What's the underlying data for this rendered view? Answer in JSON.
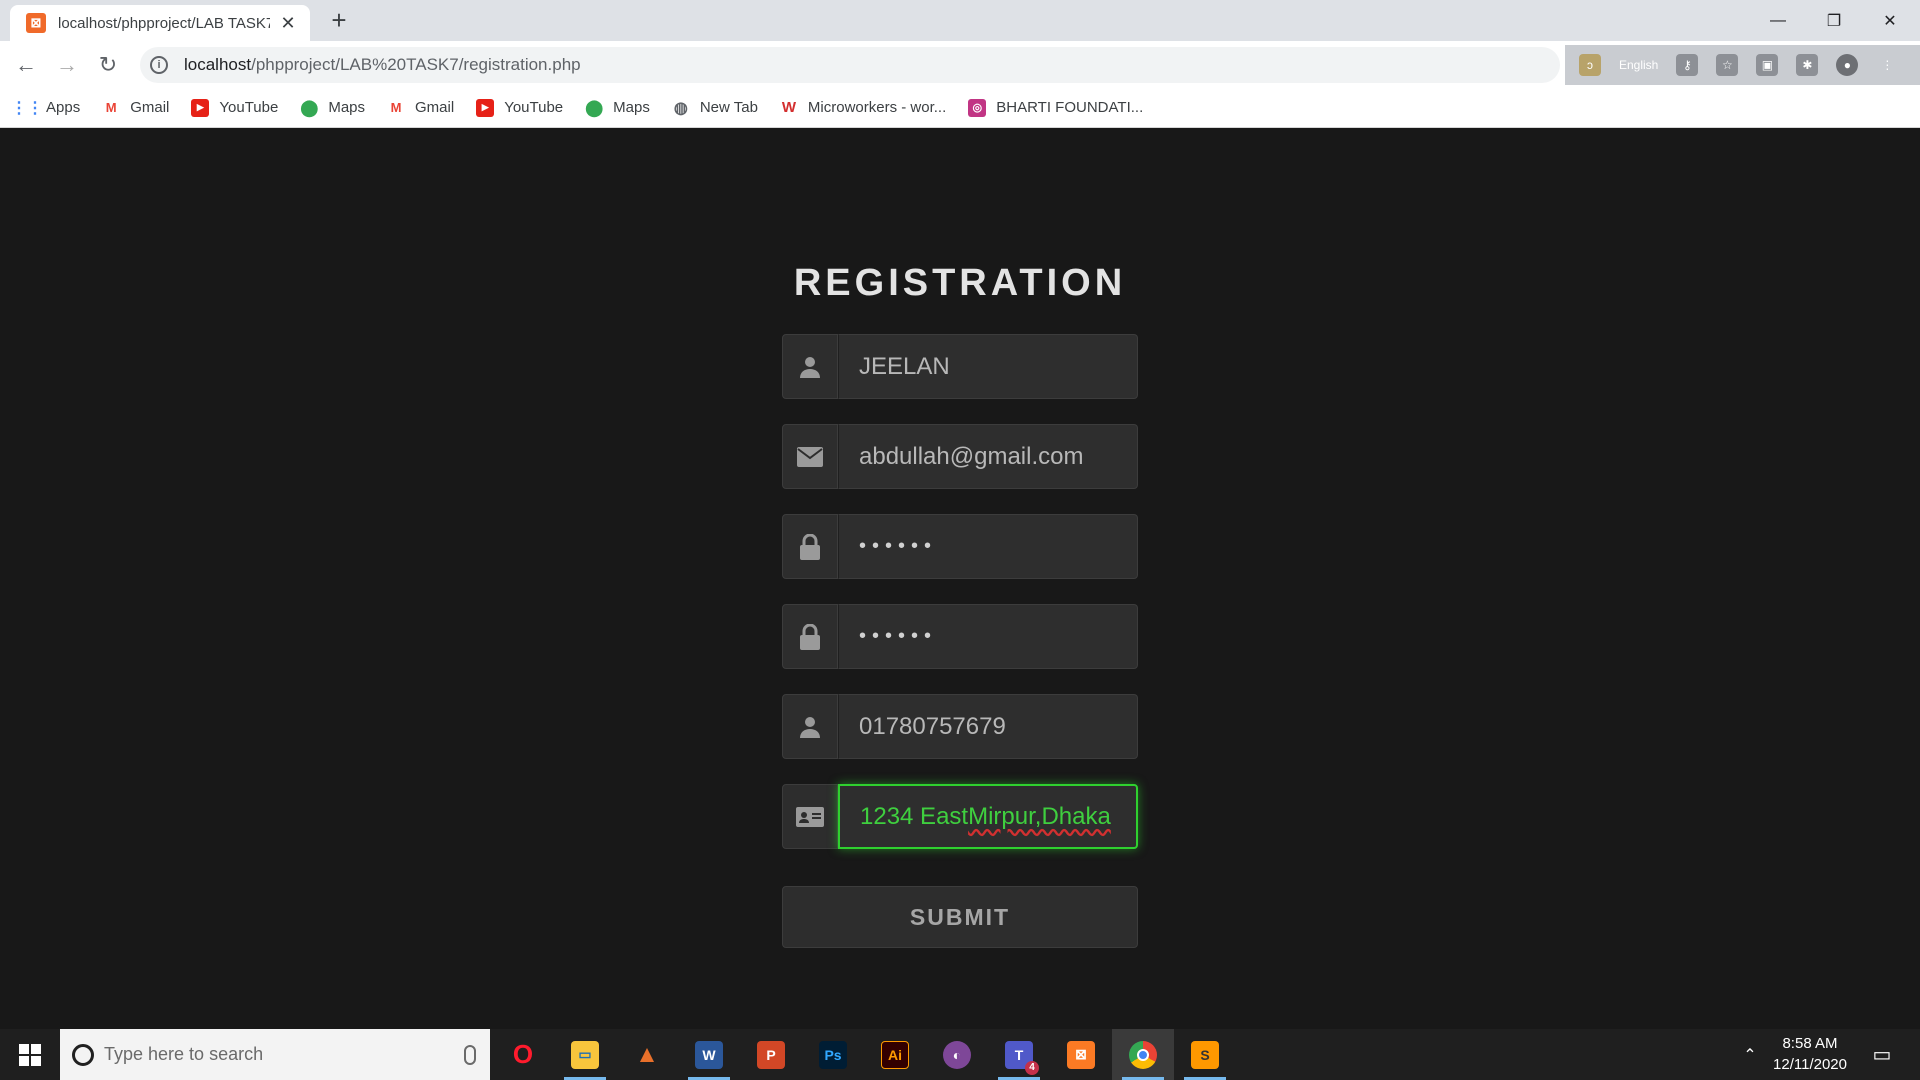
{
  "browser": {
    "tab_title": "localhost/phpproject/LAB TASK7/",
    "url_host": "localhost",
    "url_path": "/phpproject/LAB%20TASK7/registration.php",
    "extension_lang": "English"
  },
  "bookmarks": [
    {
      "label": "Apps",
      "icon": "apps-grid-icon"
    },
    {
      "label": "Gmail",
      "icon": "gmail-icon"
    },
    {
      "label": "YouTube",
      "icon": "youtube-icon"
    },
    {
      "label": "Maps",
      "icon": "maps-icon"
    },
    {
      "label": "Gmail",
      "icon": "gmail-icon"
    },
    {
      "label": "YouTube",
      "icon": "youtube-icon"
    },
    {
      "label": "Maps",
      "icon": "maps-icon"
    },
    {
      "label": "New Tab",
      "icon": "globe-icon"
    },
    {
      "label": "Microworkers - wor...",
      "icon": "microworkers-icon"
    },
    {
      "label": "BHARTI FOUNDATI...",
      "icon": "instagram-icon"
    }
  ],
  "form": {
    "title": "REGISTRATION",
    "name_value": "JEELAN",
    "email_value": "abdullah@gmail.com",
    "password_value": "••••••",
    "confirm_password_value": "••••••",
    "phone_value": "01780757679",
    "address_value_start": "1234 East ",
    "address_value_underlined": "Mirpur,Dhaka",
    "submit_label": "SUBMIT"
  },
  "colors": {
    "page_background": "#181818",
    "focus_accent": "#2fd12f"
  },
  "taskbar": {
    "search_placeholder": "Type here to search",
    "time": "8:58 AM",
    "date": "12/11/2020",
    "apps": [
      "opera",
      "file-explorer",
      "matlab",
      "word",
      "powerpoint",
      "photoshop",
      "illustrator",
      "tor",
      "teams",
      "xampp",
      "chrome",
      "sublime"
    ],
    "teams_badge": "4"
  }
}
